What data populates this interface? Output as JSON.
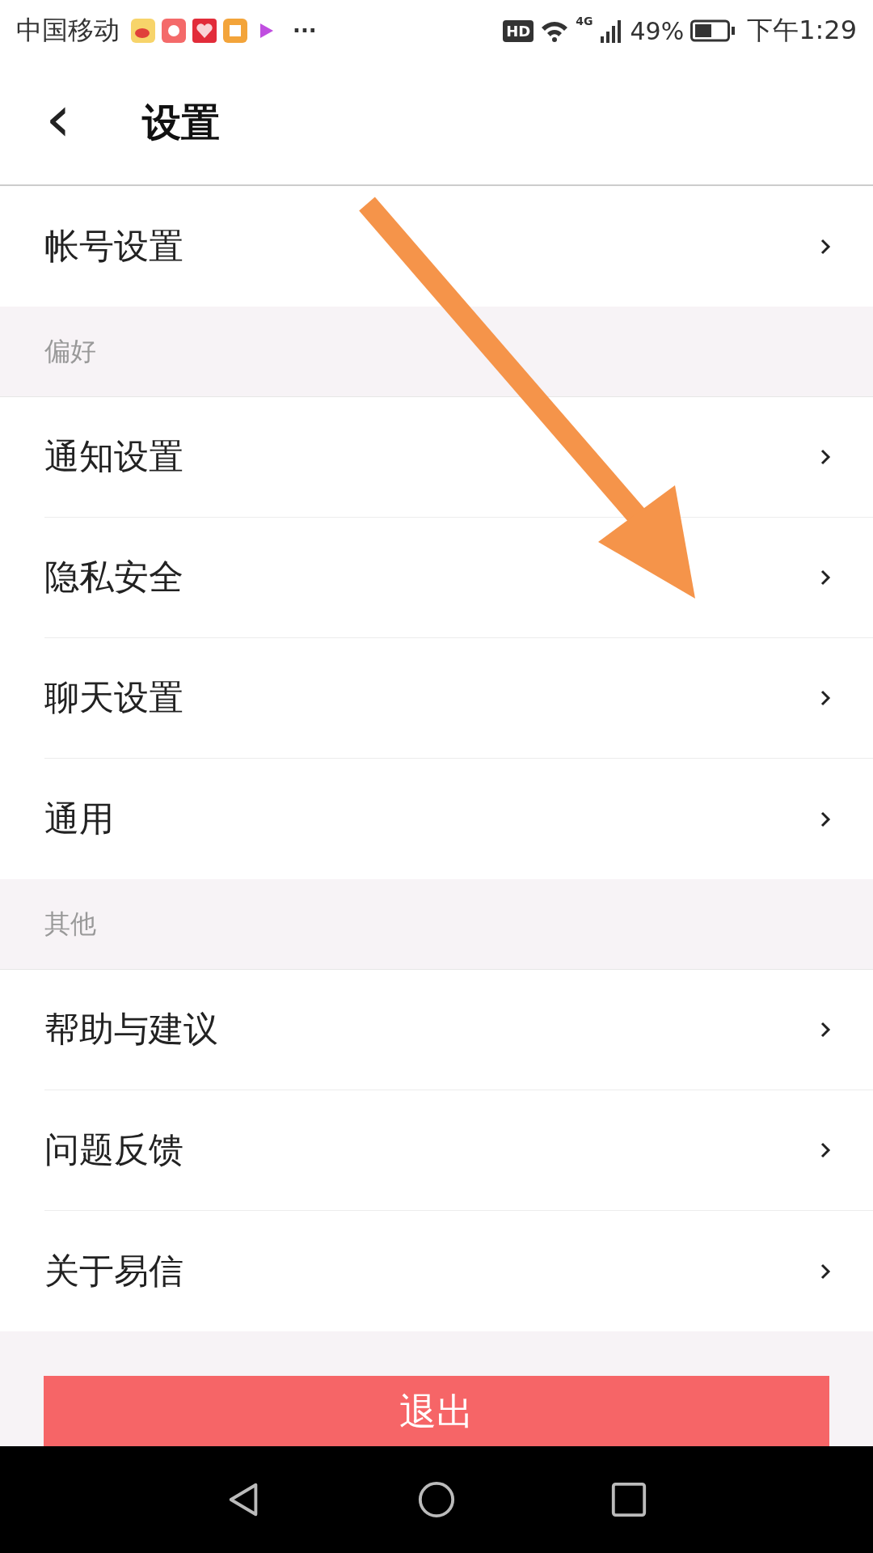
{
  "status_bar": {
    "carrier": "中国移动",
    "more": "···",
    "hd": "HD",
    "network": "4G",
    "battery": "49%",
    "time": "下午1:29"
  },
  "header": {
    "back": "‹",
    "title": "设置"
  },
  "groups": [
    {
      "items": [
        {
          "label": "帐号设置"
        }
      ]
    },
    {
      "title": "偏好",
      "items": [
        {
          "label": "通知设置"
        },
        {
          "label": "隐私安全"
        },
        {
          "label": "聊天设置"
        },
        {
          "label": "通用"
        }
      ]
    },
    {
      "title": "其他",
      "items": [
        {
          "label": "帮助与建议"
        },
        {
          "label": "问题反馈"
        },
        {
          "label": "关于易信"
        }
      ]
    }
  ],
  "logout_button": "退出"
}
